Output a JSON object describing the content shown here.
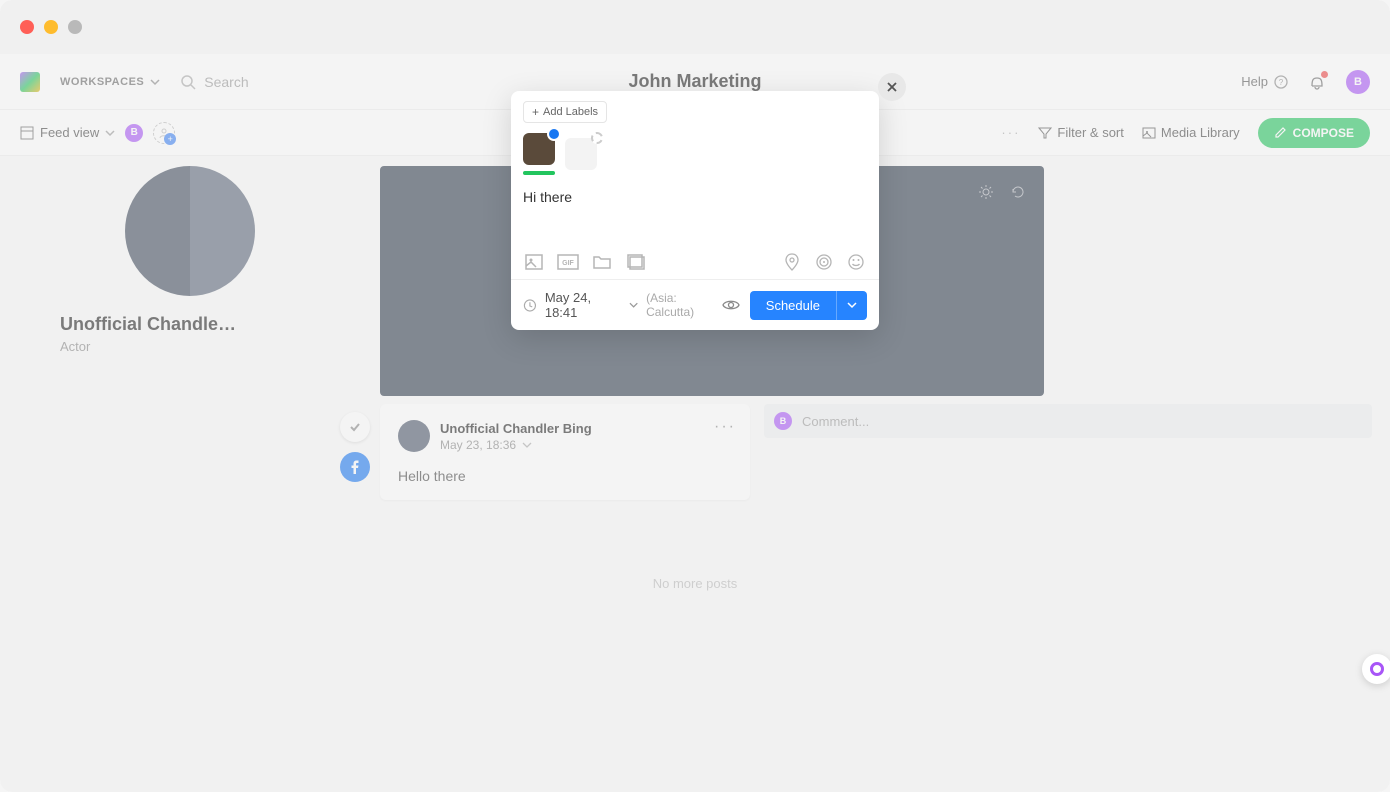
{
  "header": {
    "workspaces_label": "WORKSPACES",
    "search_placeholder": "Search",
    "title": "John Marketing",
    "help_label": "Help",
    "avatar_initial": "B"
  },
  "toolbar": {
    "feedview_label": "Feed view",
    "badge_initial": "B",
    "filter_label": "Filter & sort",
    "media_label": "Media Library",
    "compose_label": "COMPOSE"
  },
  "profile": {
    "name": "Unofficial Chandle…",
    "role": "Actor"
  },
  "post": {
    "author": "Unofficial Chandler Bing",
    "time": "May 23, 18:36",
    "body": "Hello there"
  },
  "comment": {
    "placeholder": "Comment...",
    "avatar_initial": "B"
  },
  "feed_end": "No more posts",
  "compose_modal": {
    "add_labels": "Add Labels",
    "text": "Hi there",
    "date": "May 24, 18:41",
    "timezone": "(Asia: Calcutta)",
    "schedule_label": "Schedule"
  }
}
